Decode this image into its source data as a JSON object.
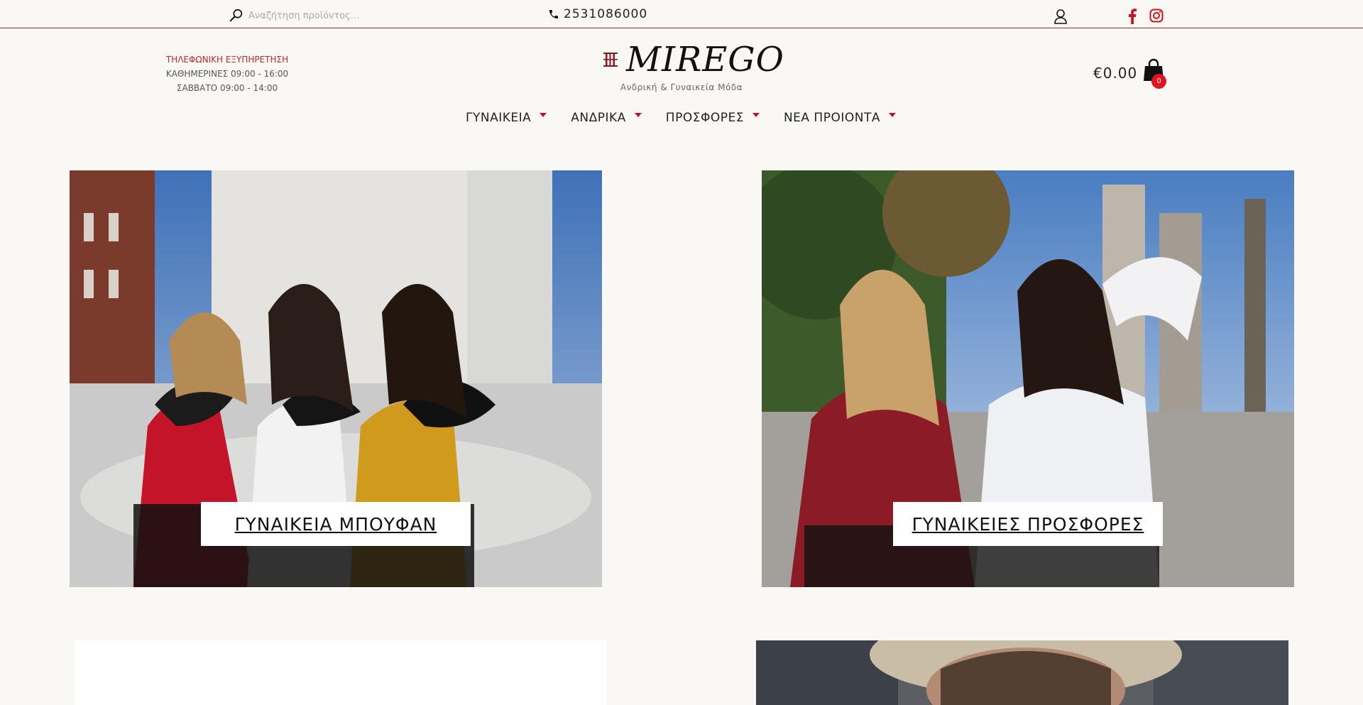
{
  "topbar": {
    "search_placeholder": "Αναζήτηση προϊόντος...",
    "phone": "2531086000"
  },
  "service": {
    "title": "ΤΗΛΕΦΩΝΙΚΗ ΕΞΥΠΗΡΕΤΗΣΗ",
    "weekdays": "ΚΑΘΗΜΕΡΙΝΕΣ 09:00 - 16:00",
    "saturday": "ΣΑΒΒΑΤΟ 09:00 - 14:00"
  },
  "logo": {
    "name": "MIREGO",
    "tagline": "Ανδρική & Γυναικεία Μόδα"
  },
  "cart": {
    "total": "€0.00",
    "count": "0"
  },
  "nav": [
    {
      "label": "ΓΥΝΑΙΚΕΙΑ"
    },
    {
      "label": "ΑΝΔΡΙΚΑ"
    },
    {
      "label": "ΠΡΟΣΦΟΡΕΣ"
    },
    {
      "label": "ΝΕΑ ΠΡΟΙΟΝΤΑ"
    }
  ],
  "banners": [
    {
      "label": "ΓΥΝΑΙΚΕΙΑ ΜΠΟΥΦΑΝ"
    },
    {
      "label": "ΓΥΝΑΙΚΕΙΕΣ ΠΡΟΣΦΟΡΕΣ"
    }
  ],
  "colors": {
    "accent": "#c0272d",
    "badge": "#e0141e",
    "background": "#f9f8f4"
  }
}
